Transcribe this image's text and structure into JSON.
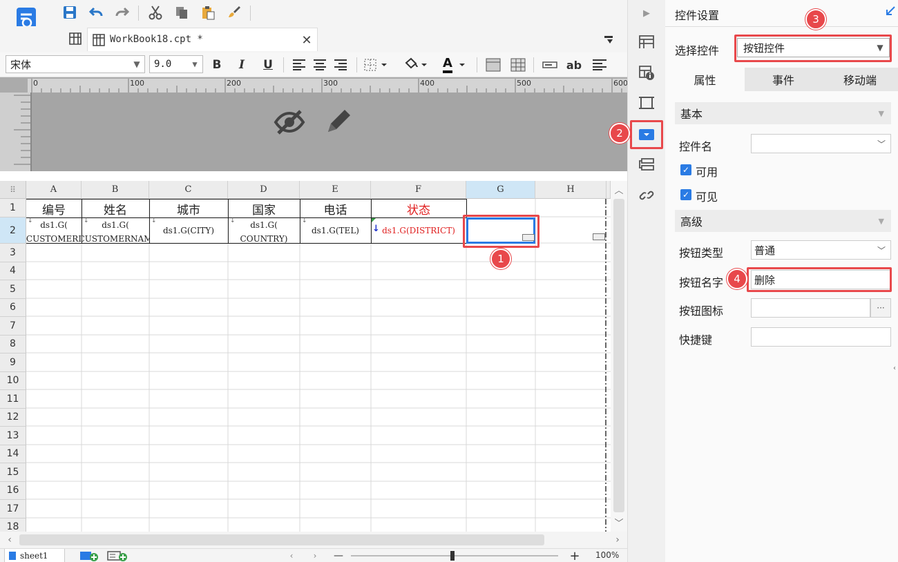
{
  "toolbar": {
    "tab_title": "WorkBook18.cpt *",
    "font_name": "宋体",
    "font_size": "9.0",
    "bold": "B",
    "italic": "I",
    "underline": "U",
    "text_style": "ab",
    "font_color": "A"
  },
  "ruler": {
    "ticks": [
      "0",
      "100",
      "200",
      "300",
      "400",
      "500",
      "600"
    ]
  },
  "grid": {
    "col_headers": [
      "A",
      "B",
      "C",
      "D",
      "E",
      "F",
      "G",
      "H"
    ],
    "row_numbers": [
      "1",
      "2",
      "3",
      "4",
      "5",
      "6",
      "7",
      "8",
      "9",
      "10",
      "11",
      "12",
      "13",
      "14",
      "15",
      "16",
      "17",
      "18"
    ],
    "row1": [
      "编号",
      "姓名",
      "城市",
      "国家",
      "电话",
      "状态"
    ],
    "row2": {
      "a": [
        "ds1.G(",
        "CUSTOMERI"
      ],
      "b": [
        "ds1.G(",
        "CUSTOMERNAM"
      ],
      "c": [
        "ds1.G(CITY)"
      ],
      "d": [
        "ds1.G(",
        "COUNTRY)"
      ],
      "e": [
        "ds1.G(TEL)"
      ],
      "f": [
        "ds1.G(DISTRICT)"
      ]
    }
  },
  "status_bar": {
    "sheet_name": "sheet1",
    "zoom": "100%",
    "zoom_minus": "—",
    "zoom_plus": "+"
  },
  "panel": {
    "title": "控件设置",
    "select_label": "选择控件",
    "select_value": "按钮控件",
    "tabs": [
      "属性",
      "事件",
      "移动端"
    ],
    "basic_section": "基本",
    "widget_name_label": "控件名",
    "widget_name_value": "",
    "enabled_label": "可用",
    "visible_label": "可见",
    "advanced_section": "高级",
    "button_type_label": "按钮类型",
    "button_type_value": "普通",
    "button_name_label": "按钮名字",
    "button_name_value": "删除",
    "button_icon_label": "按钮图标",
    "button_icon_more": "···",
    "shortcut_label": "快捷键"
  },
  "annotations": {
    "b1": "1",
    "b2": "2",
    "b3": "3",
    "b4": "4"
  },
  "colors": {
    "accent": "#2a7be4",
    "annotation_red": "#e8484b",
    "status_red": "#e02020"
  }
}
